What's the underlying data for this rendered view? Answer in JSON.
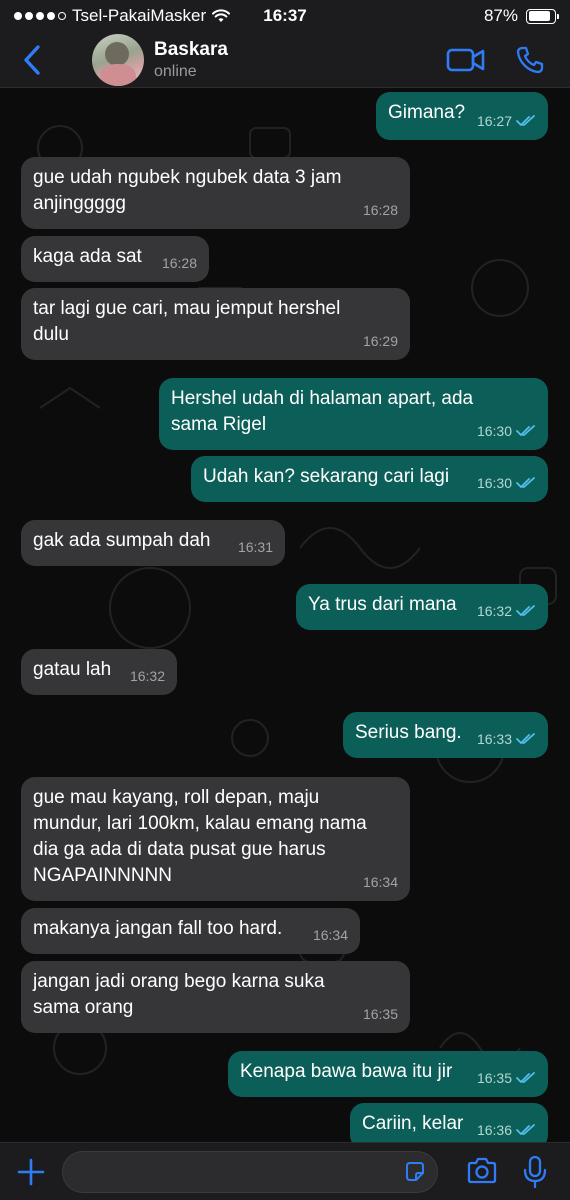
{
  "status_bar": {
    "carrier": "Tsel-PakaiMasker",
    "time": "16:37",
    "battery_pct": "87%",
    "battery_level": 0.87,
    "signal_bars": 4
  },
  "header": {
    "contact_name": "Baskara",
    "contact_status": "online"
  },
  "input": {
    "placeholder": "",
    "value": ""
  },
  "colors": {
    "accent": "#2f7cf6",
    "outgoing_bubble": "#0c5f58",
    "incoming_bubble": "#363638",
    "read_tick": "#53bdeb"
  },
  "messages": [
    {
      "dir": "out",
      "text": "Gimana?",
      "time": "16:27"
    },
    {
      "dir": "in",
      "text": "gue udah ngubek ngubek data 3 jam\nanjinggggg",
      "time": "16:28"
    },
    {
      "dir": "in",
      "text": "kaga ada sat",
      "time": "16:28"
    },
    {
      "dir": "in",
      "text": "tar lagi gue cari, mau jemput hershel\ndulu",
      "time": "16:29"
    },
    {
      "dir": "out",
      "text": "Hershel udah di halaman apart, ada\nsama Rigel",
      "time": "16:30"
    },
    {
      "dir": "out",
      "text": "Udah kan? sekarang cari lagi",
      "time": "16:30"
    },
    {
      "dir": "in",
      "text": "gak ada sumpah dah",
      "time": "16:31"
    },
    {
      "dir": "out",
      "text": "Ya trus dari mana",
      "time": "16:32"
    },
    {
      "dir": "in",
      "text": "gatau lah",
      "time": "16:32"
    },
    {
      "dir": "out",
      "text": "Serius bang.",
      "time": "16:33"
    },
    {
      "dir": "in",
      "text": "gue mau kayang, roll depan, maju\nmundur, lari 100km, kalau emang nama\ndia ga ada di data pusat gue harus\nNGAPAINNNNN",
      "time": "16:34"
    },
    {
      "dir": "in",
      "text": "makanya jangan fall too hard.",
      "time": "16:34"
    },
    {
      "dir": "in",
      "text": "jangan jadi orang bego karna suka\nsama orang",
      "time": "16:35"
    },
    {
      "dir": "out",
      "text": "Kenapa bawa bawa itu jir",
      "time": "16:35"
    },
    {
      "dir": "out",
      "text": "Cariin, kelar",
      "time": "16:36"
    }
  ]
}
